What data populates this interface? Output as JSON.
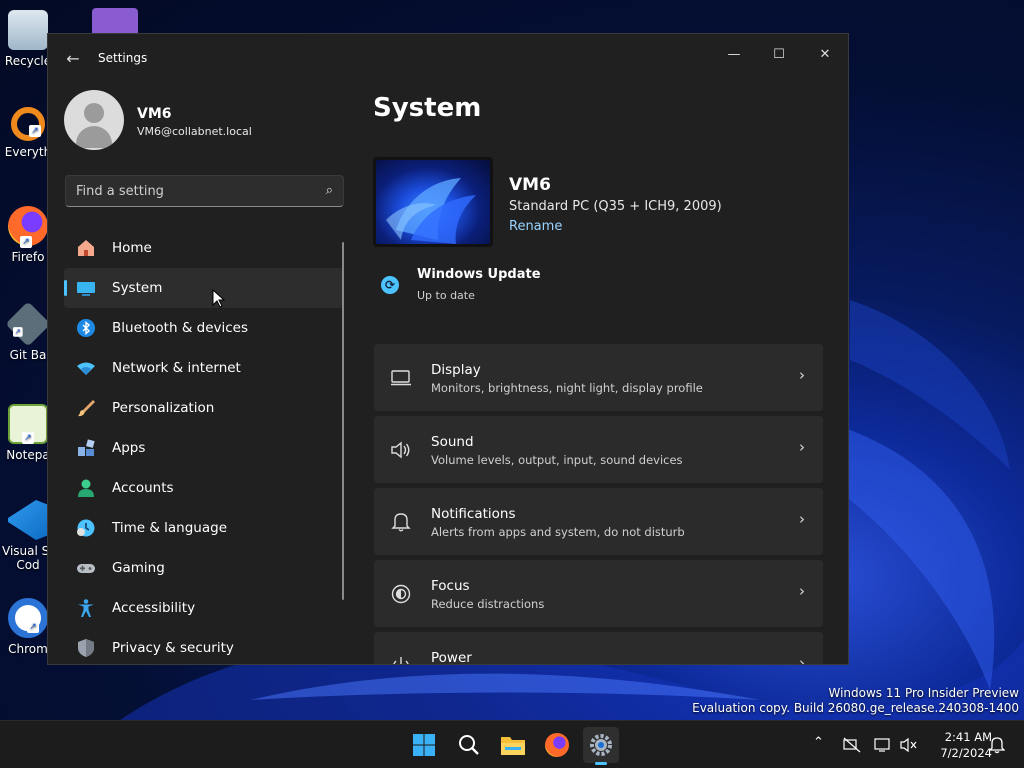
{
  "desktop": {
    "icons": [
      {
        "label": "Recycle",
        "icon": "recycle-bin-icon"
      },
      {
        "label": "Everyth",
        "icon": "everything-search-icon"
      },
      {
        "label": "Firefo",
        "icon": "firefox-icon"
      },
      {
        "label": "Git Ba",
        "icon": "git-bash-icon"
      },
      {
        "label": "Notepa",
        "icon": "notepad-icon"
      },
      {
        "label": "Visual St\nCod",
        "icon": "vscode-icon"
      },
      {
        "label": "Chrom",
        "icon": "chrome-icon"
      }
    ]
  },
  "window": {
    "title": "Settings",
    "controls": {
      "minimize": "—",
      "maximize": "☐",
      "close": "✕"
    }
  },
  "profile": {
    "name": "VM6",
    "email": "VM6@collabnet.local"
  },
  "search": {
    "placeholder": "Find a setting"
  },
  "nav": {
    "items": [
      {
        "label": "Home",
        "icon": "home-icon",
        "active": false
      },
      {
        "label": "System",
        "icon": "system-icon",
        "active": true
      },
      {
        "label": "Bluetooth & devices",
        "icon": "bluetooth-icon",
        "active": false
      },
      {
        "label": "Network & internet",
        "icon": "network-icon",
        "active": false
      },
      {
        "label": "Personalization",
        "icon": "brush-icon",
        "active": false
      },
      {
        "label": "Apps",
        "icon": "apps-icon",
        "active": false
      },
      {
        "label": "Accounts",
        "icon": "accounts-icon",
        "active": false
      },
      {
        "label": "Time & language",
        "icon": "clock-globe-icon",
        "active": false
      },
      {
        "label": "Gaming",
        "icon": "gamepad-icon",
        "active": false
      },
      {
        "label": "Accessibility",
        "icon": "accessibility-icon",
        "active": false
      },
      {
        "label": "Privacy & security",
        "icon": "shield-icon",
        "active": false
      }
    ]
  },
  "main": {
    "title": "System",
    "pc": {
      "name": "VM6",
      "model": "Standard PC (Q35 + ICH9, 2009)",
      "rename": "Rename"
    },
    "update": {
      "title": "Windows Update",
      "status": "Up to date"
    },
    "cards": [
      {
        "title": "Display",
        "desc": "Monitors, brightness, night light, display profile",
        "icon": "display-icon"
      },
      {
        "title": "Sound",
        "desc": "Volume levels, output, input, sound devices",
        "icon": "speaker-icon"
      },
      {
        "title": "Notifications",
        "desc": "Alerts from apps and system, do not disturb",
        "icon": "bell-icon"
      },
      {
        "title": "Focus",
        "desc": "Reduce distractions",
        "icon": "focus-icon"
      },
      {
        "title": "Power",
        "desc": "",
        "icon": "power-icon"
      }
    ]
  },
  "watermark": {
    "line1": "Windows 11 Pro Insider Preview",
    "line2": "Evaluation copy. Build 26080.ge_release.240308-1400"
  },
  "taskbar": {
    "apps": [
      "start-icon",
      "search-icon",
      "file-explorer-icon",
      "firefox-icon",
      "settings-icon"
    ],
    "time": "2:41 AM",
    "date": "7/2/2024"
  },
  "colors": {
    "accent": "#4cc2ff",
    "window_bg": "#202020",
    "card_bg": "#2b2b2b"
  }
}
